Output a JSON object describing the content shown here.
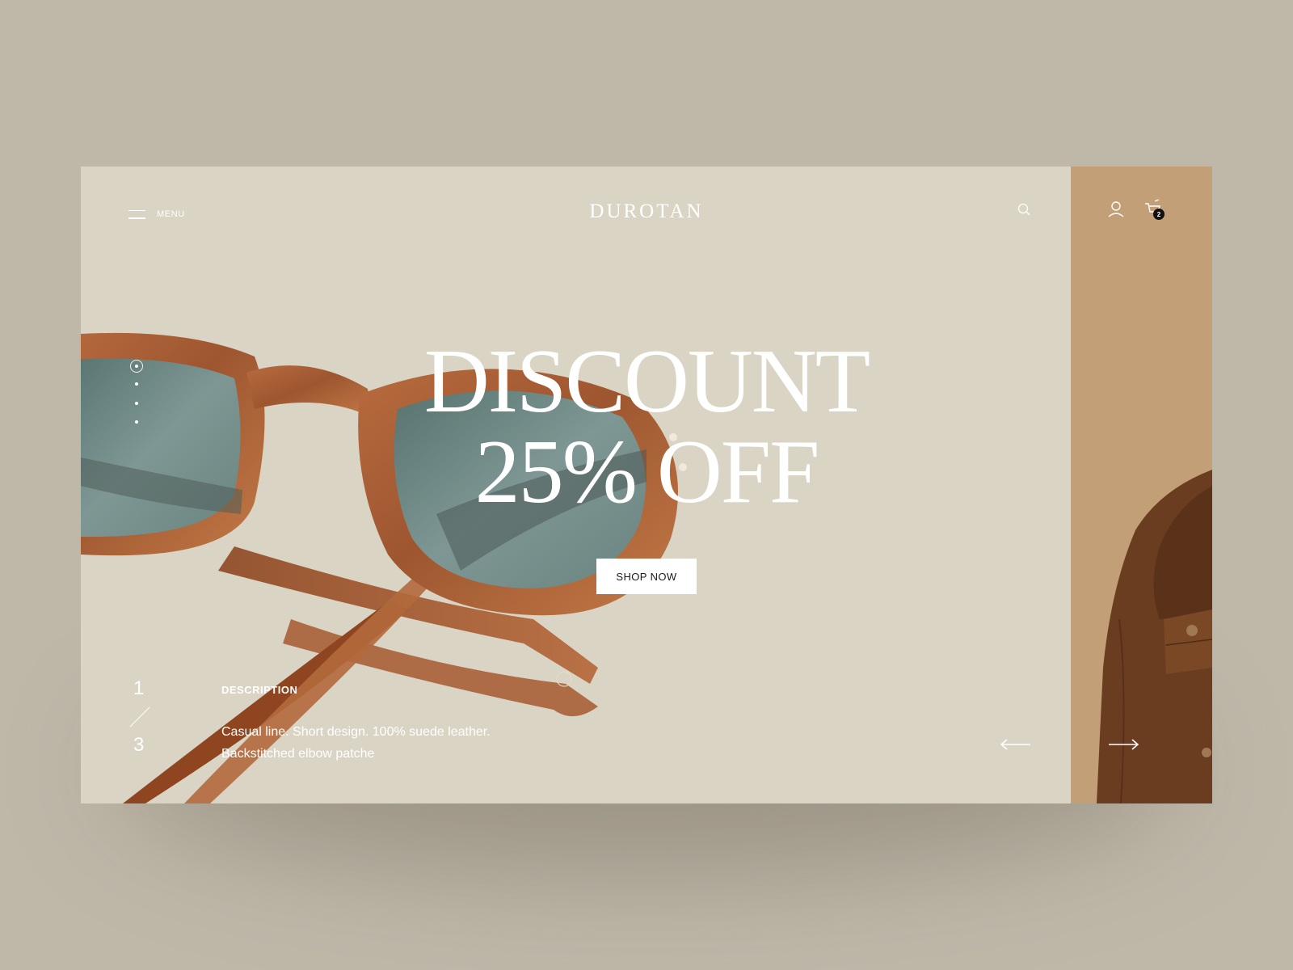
{
  "header": {
    "menu_label": "MENU",
    "brand": "DUROTAN",
    "cart_count": "2"
  },
  "icons": {
    "menu": "hamburger-icon",
    "search": "search-icon",
    "user": "user-icon",
    "cart": "cart-icon",
    "prev": "arrow-left-icon",
    "next": "arrow-right-icon"
  },
  "hero": {
    "headline_line1": "DISCOUNT",
    "headline_line2": "25% OFF",
    "cta_label": "SHOP NOW"
  },
  "slides": {
    "current": "1",
    "total": "3",
    "dot_count": 4,
    "active_dot": 1
  },
  "description": {
    "title": "DESCRIPTION",
    "text": "Casual line. Short design. 100% suede leather. Backstitched elbow patche"
  },
  "colors": {
    "page_background": "#bfb8a9",
    "hero_background": "#dad4c5",
    "side_panel": "#c29f76",
    "frame_tortoise": "#a35c35",
    "lens": "#6f8a87",
    "jacket": "#6e3f21",
    "text": "#ffffff",
    "badge": "#111111"
  }
}
